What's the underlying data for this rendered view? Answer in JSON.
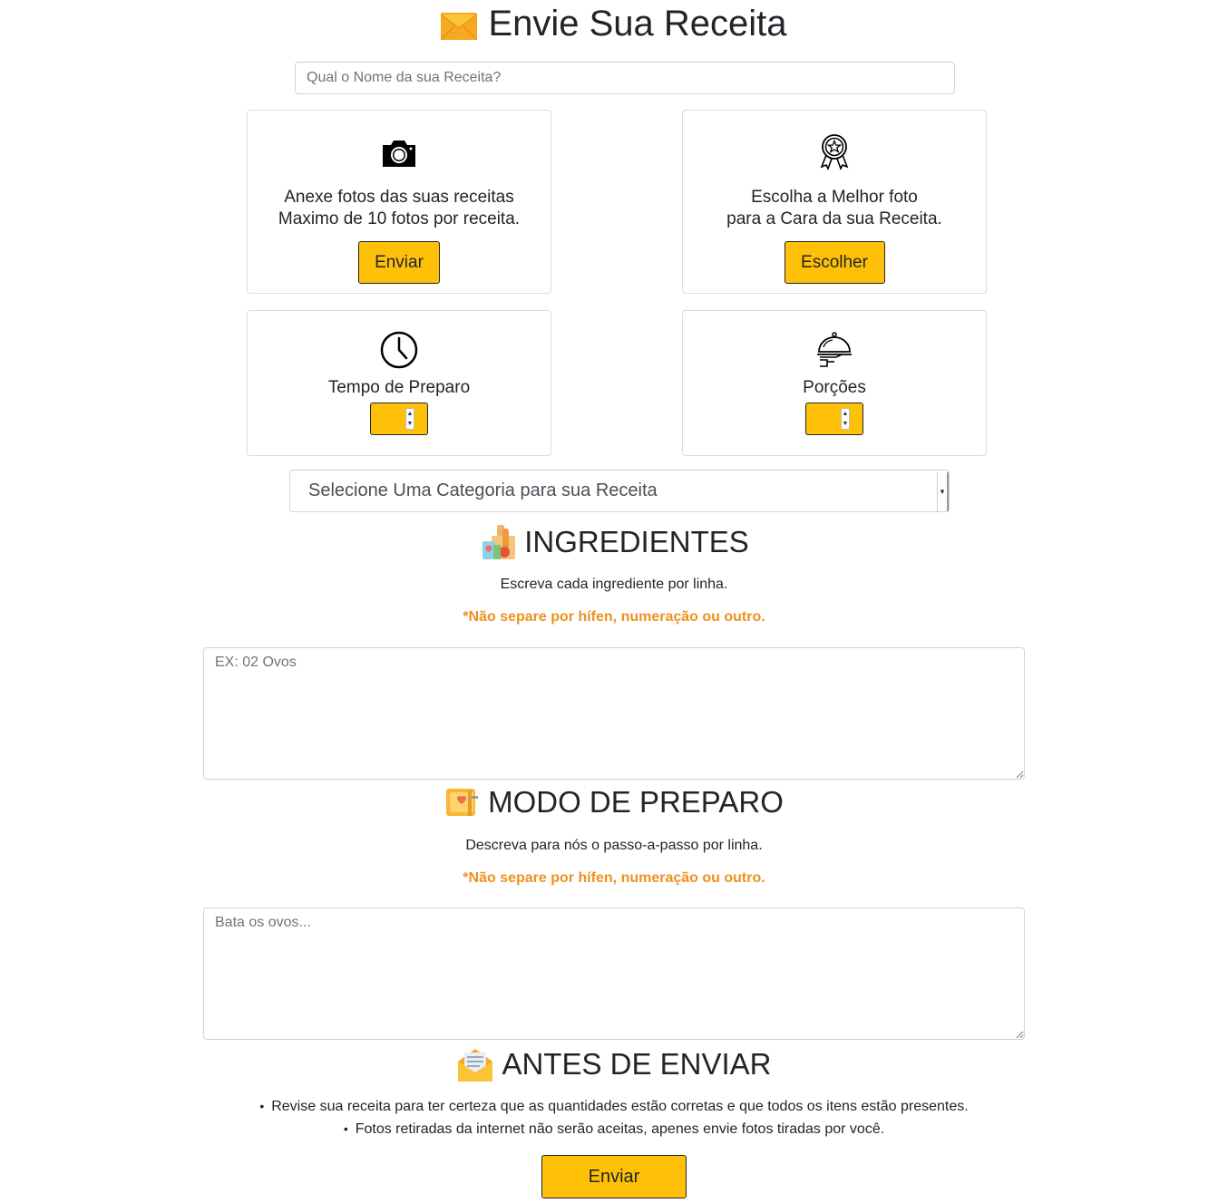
{
  "header": {
    "title": "Envie Sua Receita",
    "icon": "envelope-icon"
  },
  "recipe_name": {
    "placeholder": "Qual o Nome da sua Receita?"
  },
  "cards": {
    "photos": {
      "icon": "camera-icon",
      "line1": "Anexe fotos das suas receitas",
      "line2": "Maximo de 10 fotos por receita.",
      "button": "Enviar"
    },
    "best_photo": {
      "icon": "award-ribbon-icon",
      "line1": "Escolha a Melhor foto",
      "line2": "para a Cara da sua Receita.",
      "button": "Escolher"
    },
    "prep_time": {
      "icon": "clock-icon",
      "label": "Tempo de Preparo"
    },
    "portions": {
      "icon": "serving-dish-icon",
      "label": "Porções"
    }
  },
  "category": {
    "selected": "Selecione Uma Categoria para sua Receita"
  },
  "ingredients": {
    "icon": "groceries-icon",
    "heading": "INGREDIENTES",
    "instruction": "Escreva cada ingrediente por linha.",
    "warning": "*Não separe por hífen, numeração ou outro.",
    "placeholder": "EX: 02 Ovos"
  },
  "method": {
    "icon": "recipe-book-icon",
    "heading": "MODO DE PREPARO",
    "instruction": "Descreva para nós o passo-a-passo por linha.",
    "warning": "*Não separe por hífen, numeração ou outro.",
    "placeholder": "Bata os ovos..."
  },
  "before_send": {
    "icon": "open-envelope-icon",
    "heading": "ANTES DE ENVIAR",
    "tips": [
      "Revise sua receita para ter certeza que as quantidades estão corretas e que todos os itens estão presentes.",
      "Fotos retiradas da internet não serão aceitas, apenes envie fotos tiradas por você."
    ]
  },
  "submit": {
    "label": "Enviar"
  },
  "colors": {
    "accent": "#ffc107",
    "warning_text": "#f0901f"
  }
}
